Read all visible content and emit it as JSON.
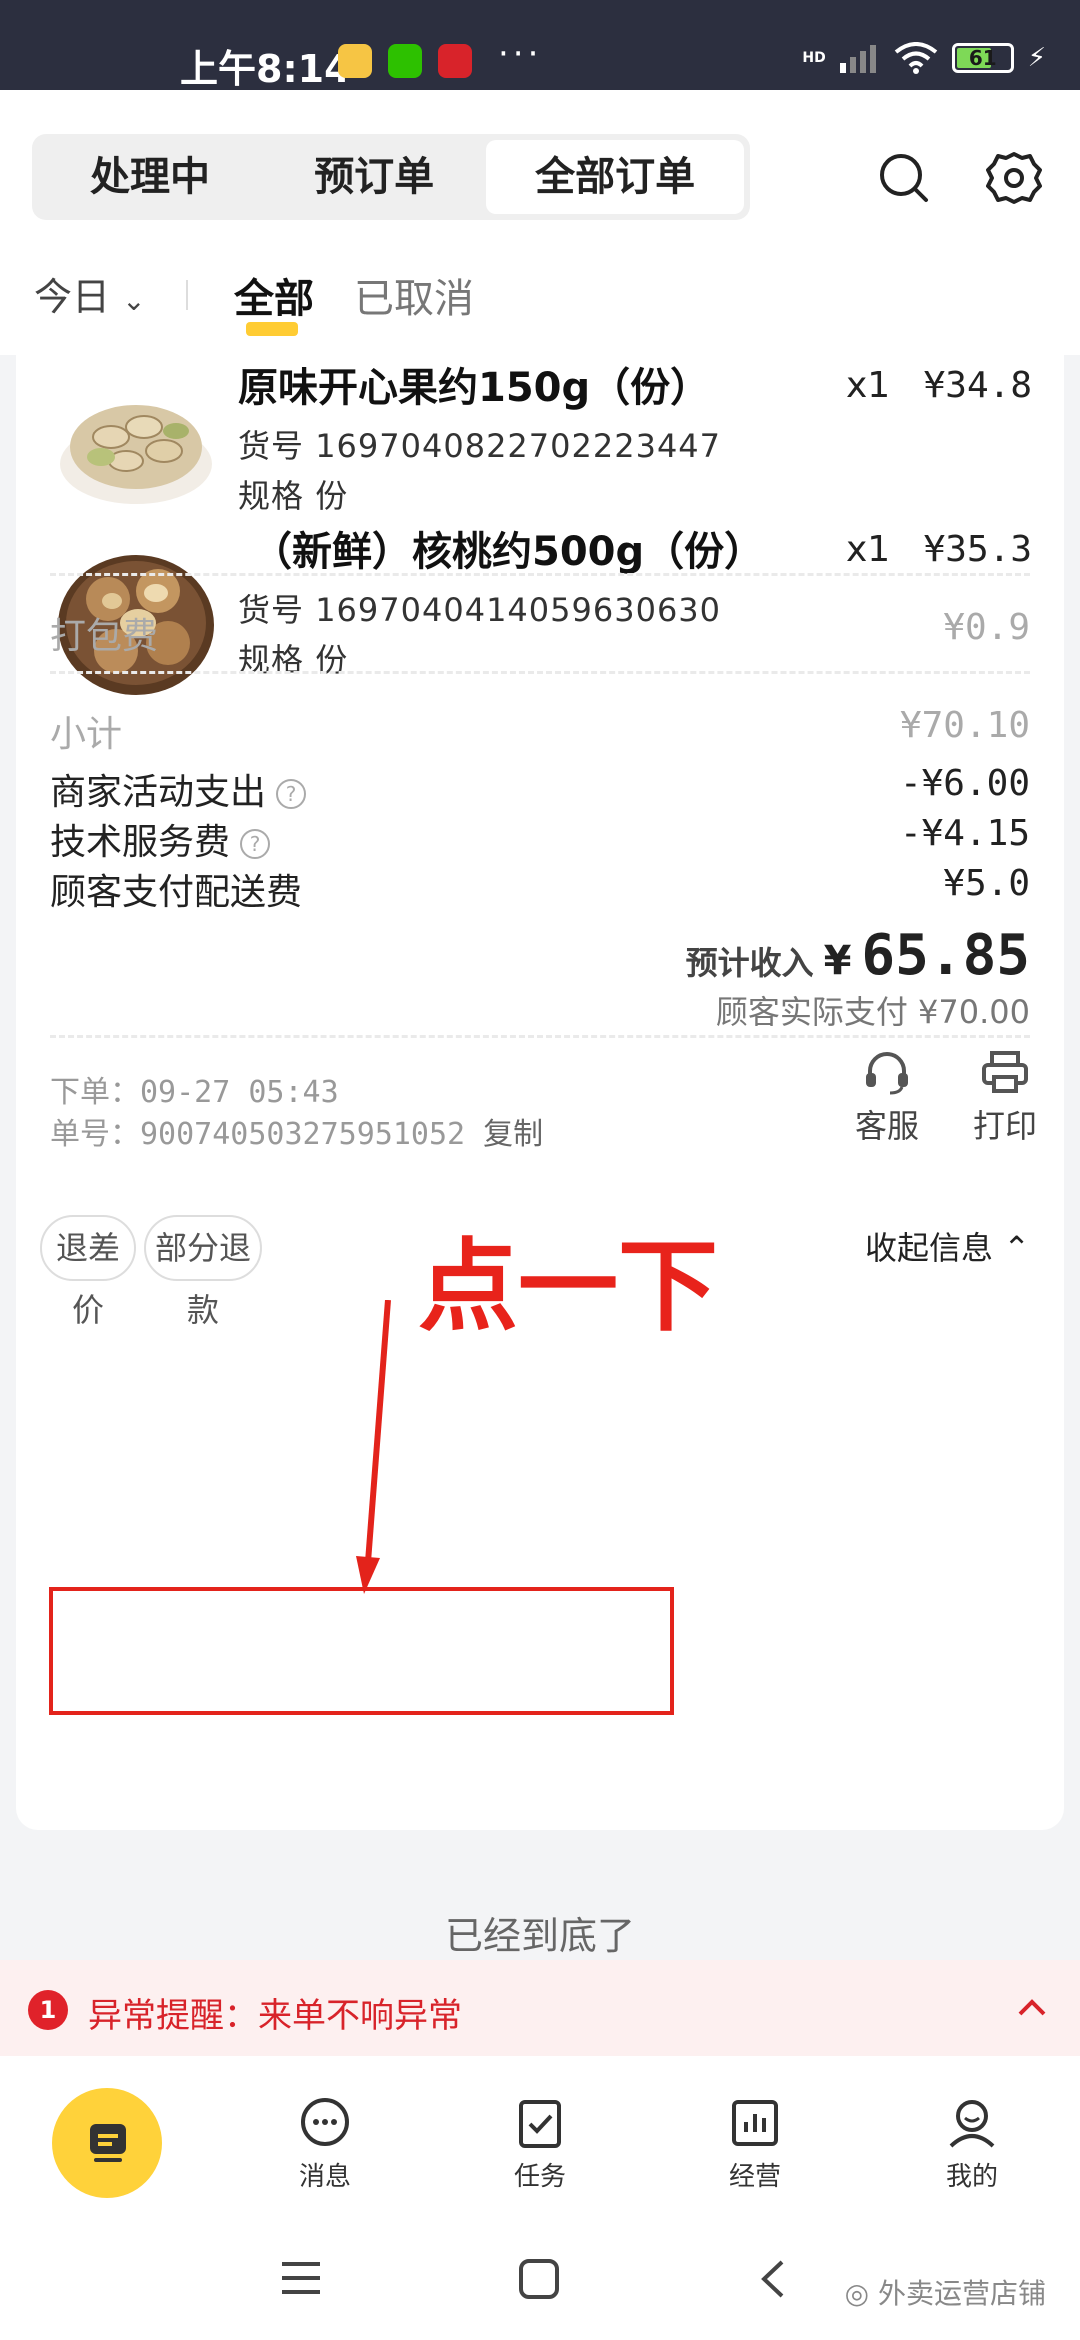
{
  "status_bar": {
    "time": "上午8:14",
    "network": "HD",
    "battery": "61"
  },
  "header": {
    "tabs": [
      "处理中",
      "预订单",
      "全部订单"
    ],
    "filter": {
      "date": "今日",
      "tab_all": "全部",
      "tab_cancelled": "已取消"
    }
  },
  "products": [
    {
      "name": "原味开心果约150g（份）",
      "sku_label": "货号",
      "sku": "1697040822702223447",
      "spec_label": "规格",
      "spec": "份",
      "qty": "x1",
      "price": "¥34.8"
    },
    {
      "name": "（新鲜）核桃约500g（份）",
      "sku_label": "货号",
      "sku": "1697040414059630630",
      "spec_label": "规格",
      "spec": "份",
      "qty": "x1",
      "price": "¥35.3"
    }
  ],
  "fees": {
    "packing_label": "打包费",
    "packing": "¥0.9",
    "subtotal_label": "小计",
    "subtotal": "¥70.10",
    "promo_label": "商家活动支出",
    "promo": "-¥6.00",
    "service_label": "技术服务费",
    "service": "-¥4.15",
    "delivery_label": "顾客支付配送费",
    "delivery": "¥5.0"
  },
  "income": {
    "label": "预计收入",
    "symbol": "¥",
    "value": "65.85",
    "paid": "顾客实际支付 ¥70.00"
  },
  "order": {
    "placed_label": "下单：",
    "placed": "09-27 05:43",
    "number_label": "单号：",
    "number": "900740503275951052",
    "copy": "复制"
  },
  "actions": {
    "service": "客服",
    "print": "打印",
    "refund_diff": "退差价",
    "partial_refund": "部分退款",
    "collapse": "收起信息"
  },
  "annotation": "点一下",
  "end_text": "已经到底了",
  "alert": {
    "count": "1",
    "text": "异常提醒：来单不响异常"
  },
  "tabbar": {
    "messages": "消息",
    "tasks": "任务",
    "business": "经营",
    "mine": "我的"
  },
  "watermark": "外卖运营店铺",
  "colors": {
    "accent": "#ffcc33",
    "alert_red": "#d8232a",
    "annotation_red": "#e3231b"
  }
}
